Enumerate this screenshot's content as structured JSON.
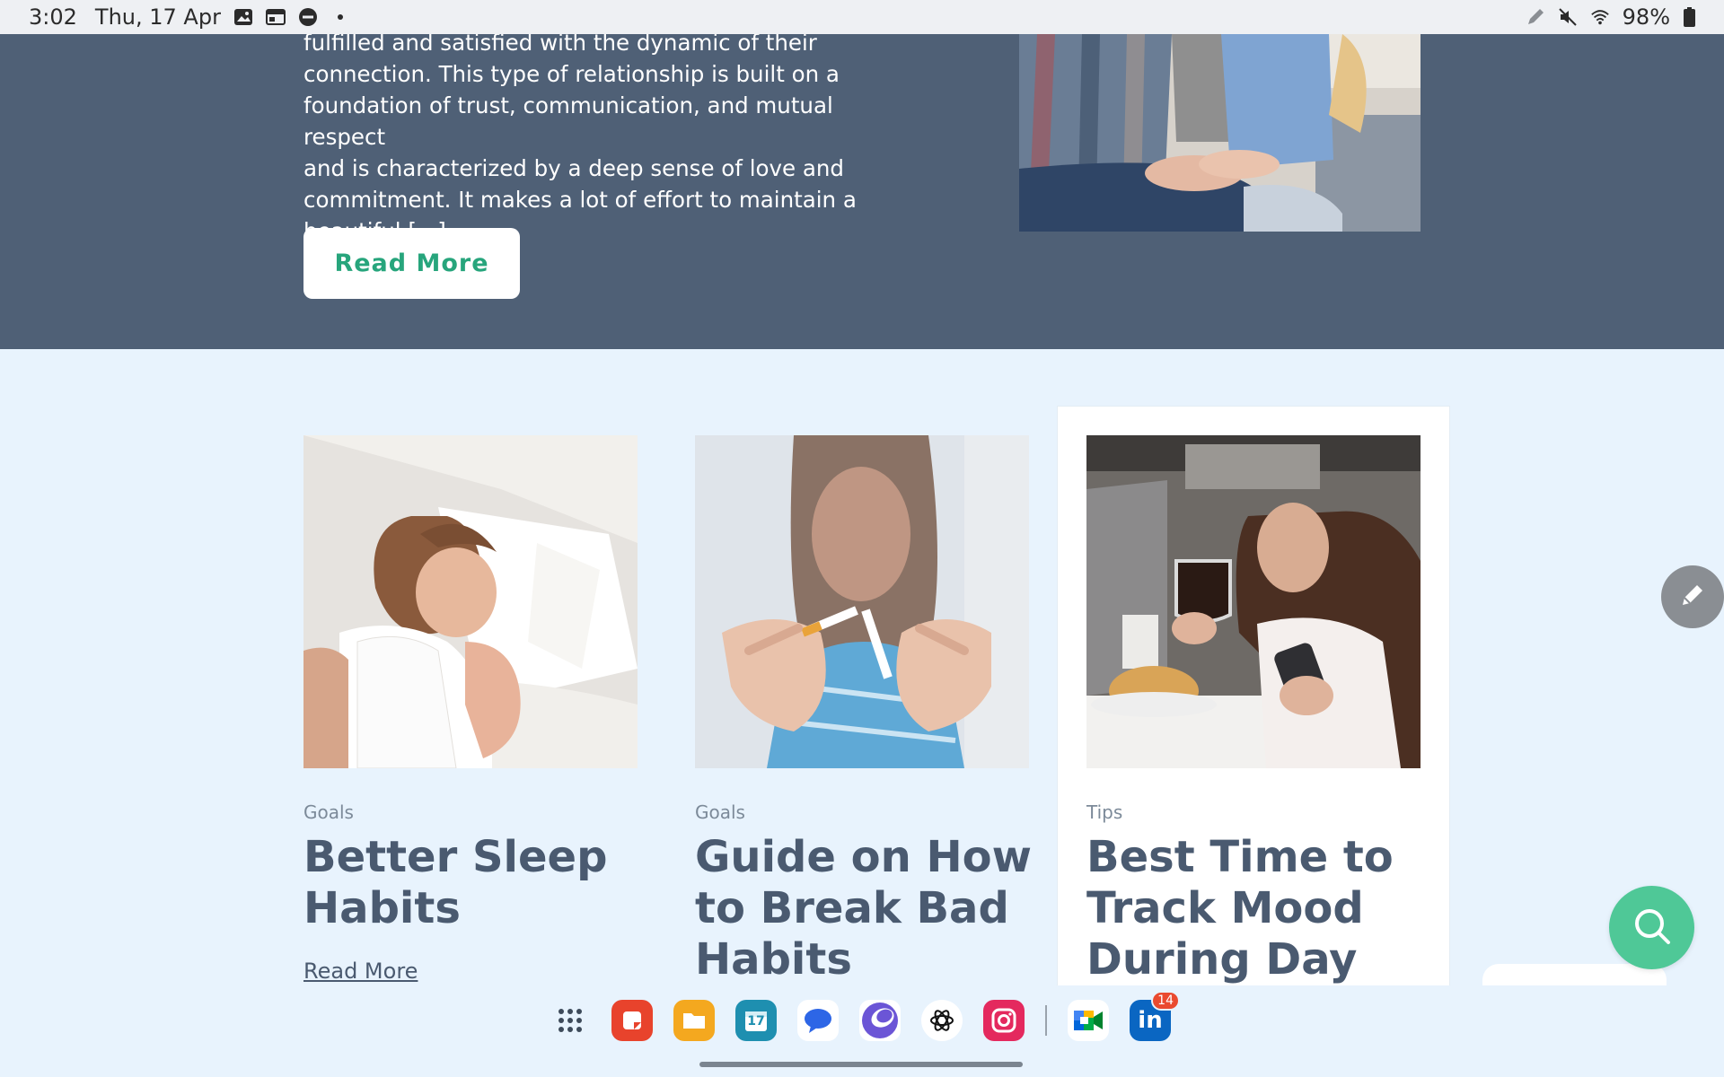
{
  "status_bar": {
    "time": "3:02",
    "date": "Thu, 17 Apr",
    "battery": "98%",
    "icons_left": [
      "gallery-icon",
      "calendar-widget-icon",
      "dnd-icon",
      "dot-icon"
    ],
    "icons_right": [
      "pen-icon",
      "mute-icon",
      "wifi-icon",
      "battery-icon"
    ]
  },
  "hero": {
    "text_lines": [
      "fulfilled and satisfied with the dynamic of their",
      "connection. This type of relationship is built on a",
      "foundation of trust, communication, and mutual respect",
      "and is characterized by a deep sense of love and",
      "commitment. It makes a lot of effort to maintain a",
      "beautiful [...]"
    ],
    "button_label": "Read More",
    "image_alt": "couple sitting on sofa holding hands"
  },
  "cards": [
    {
      "category": "Goals",
      "title": "Better Sleep Habits",
      "title_lines": [
        "Better Sleep",
        "Habits"
      ],
      "link": "Read More",
      "image": "woman-sleeping"
    },
    {
      "category": "Goals",
      "title": "Guide on How to Break Bad Habits",
      "title_lines": [
        "Guide on How",
        "to Break Bad",
        "Habits"
      ],
      "image": "breaking-cigarette"
    },
    {
      "category": "Tips",
      "title": "Best Time to Track Mood During Day",
      "title_lines": [
        "Best Time to",
        "Track Mood",
        "During Day"
      ],
      "image": "woman-with-coffee"
    }
  ],
  "fabs": {
    "edit": "pencil-icon",
    "search": "search-icon"
  },
  "dock": {
    "apps": [
      {
        "name": "app-drawer",
        "icon": "grid-icon"
      },
      {
        "name": "notes",
        "icon": "notes-icon",
        "color": "#e8432c"
      },
      {
        "name": "files",
        "icon": "folder-icon",
        "color": "#f4a81f"
      },
      {
        "name": "calendar",
        "icon": "calendar-icon",
        "color": "#1e8fb0",
        "label": "17"
      },
      {
        "name": "messages",
        "icon": "messages-icon",
        "color": "#2d66e6"
      },
      {
        "name": "browser",
        "icon": "browser-icon",
        "color": "#6b55d6"
      },
      {
        "name": "chatgpt",
        "icon": "chatgpt-icon",
        "color": "#ffffff"
      },
      {
        "name": "instagram",
        "icon": "instagram-icon",
        "color": "#e4295e"
      },
      {
        "name": "meet",
        "icon": "meet-icon"
      },
      {
        "name": "linkedin",
        "icon": "linkedin-icon",
        "color": "#0a66c2",
        "badge": "14"
      }
    ]
  }
}
